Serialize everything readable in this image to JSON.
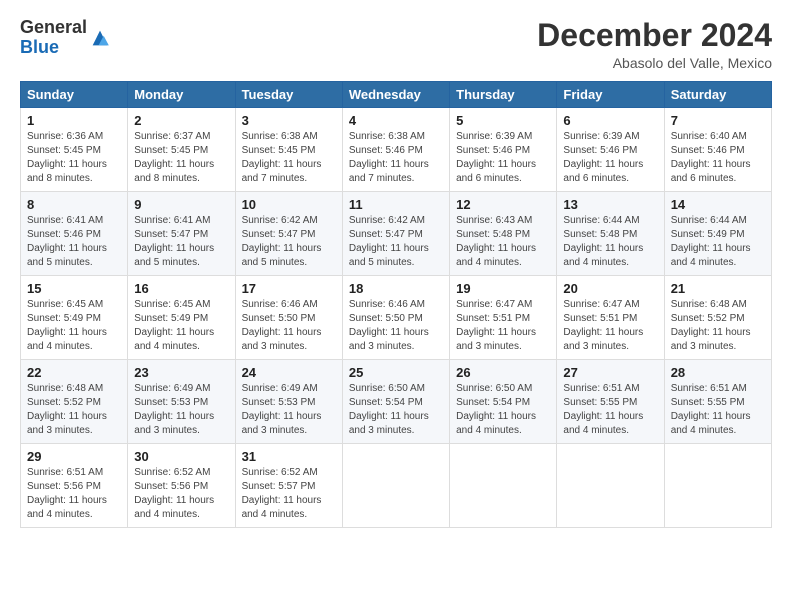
{
  "logo": {
    "general": "General",
    "blue": "Blue"
  },
  "title": "December 2024",
  "location": "Abasolo del Valle, Mexico",
  "weekdays": [
    "Sunday",
    "Monday",
    "Tuesday",
    "Wednesday",
    "Thursday",
    "Friday",
    "Saturday"
  ],
  "weeks": [
    [
      {
        "day": "1",
        "sunrise": "6:36 AM",
        "sunset": "5:45 PM",
        "daylight": "11 hours and 8 minutes."
      },
      {
        "day": "2",
        "sunrise": "6:37 AM",
        "sunset": "5:45 PM",
        "daylight": "11 hours and 8 minutes."
      },
      {
        "day": "3",
        "sunrise": "6:38 AM",
        "sunset": "5:45 PM",
        "daylight": "11 hours and 7 minutes."
      },
      {
        "day": "4",
        "sunrise": "6:38 AM",
        "sunset": "5:46 PM",
        "daylight": "11 hours and 7 minutes."
      },
      {
        "day": "5",
        "sunrise": "6:39 AM",
        "sunset": "5:46 PM",
        "daylight": "11 hours and 6 minutes."
      },
      {
        "day": "6",
        "sunrise": "6:39 AM",
        "sunset": "5:46 PM",
        "daylight": "11 hours and 6 minutes."
      },
      {
        "day": "7",
        "sunrise": "6:40 AM",
        "sunset": "5:46 PM",
        "daylight": "11 hours and 6 minutes."
      }
    ],
    [
      {
        "day": "8",
        "sunrise": "6:41 AM",
        "sunset": "5:46 PM",
        "daylight": "11 hours and 5 minutes."
      },
      {
        "day": "9",
        "sunrise": "6:41 AM",
        "sunset": "5:47 PM",
        "daylight": "11 hours and 5 minutes."
      },
      {
        "day": "10",
        "sunrise": "6:42 AM",
        "sunset": "5:47 PM",
        "daylight": "11 hours and 5 minutes."
      },
      {
        "day": "11",
        "sunrise": "6:42 AM",
        "sunset": "5:47 PM",
        "daylight": "11 hours and 5 minutes."
      },
      {
        "day": "12",
        "sunrise": "6:43 AM",
        "sunset": "5:48 PM",
        "daylight": "11 hours and 4 minutes."
      },
      {
        "day": "13",
        "sunrise": "6:44 AM",
        "sunset": "5:48 PM",
        "daylight": "11 hours and 4 minutes."
      },
      {
        "day": "14",
        "sunrise": "6:44 AM",
        "sunset": "5:49 PM",
        "daylight": "11 hours and 4 minutes."
      }
    ],
    [
      {
        "day": "15",
        "sunrise": "6:45 AM",
        "sunset": "5:49 PM",
        "daylight": "11 hours and 4 minutes."
      },
      {
        "day": "16",
        "sunrise": "6:45 AM",
        "sunset": "5:49 PM",
        "daylight": "11 hours and 4 minutes."
      },
      {
        "day": "17",
        "sunrise": "6:46 AM",
        "sunset": "5:50 PM",
        "daylight": "11 hours and 3 minutes."
      },
      {
        "day": "18",
        "sunrise": "6:46 AM",
        "sunset": "5:50 PM",
        "daylight": "11 hours and 3 minutes."
      },
      {
        "day": "19",
        "sunrise": "6:47 AM",
        "sunset": "5:51 PM",
        "daylight": "11 hours and 3 minutes."
      },
      {
        "day": "20",
        "sunrise": "6:47 AM",
        "sunset": "5:51 PM",
        "daylight": "11 hours and 3 minutes."
      },
      {
        "day": "21",
        "sunrise": "6:48 AM",
        "sunset": "5:52 PM",
        "daylight": "11 hours and 3 minutes."
      }
    ],
    [
      {
        "day": "22",
        "sunrise": "6:48 AM",
        "sunset": "5:52 PM",
        "daylight": "11 hours and 3 minutes."
      },
      {
        "day": "23",
        "sunrise": "6:49 AM",
        "sunset": "5:53 PM",
        "daylight": "11 hours and 3 minutes."
      },
      {
        "day": "24",
        "sunrise": "6:49 AM",
        "sunset": "5:53 PM",
        "daylight": "11 hours and 3 minutes."
      },
      {
        "day": "25",
        "sunrise": "6:50 AM",
        "sunset": "5:54 PM",
        "daylight": "11 hours and 3 minutes."
      },
      {
        "day": "26",
        "sunrise": "6:50 AM",
        "sunset": "5:54 PM",
        "daylight": "11 hours and 4 minutes."
      },
      {
        "day": "27",
        "sunrise": "6:51 AM",
        "sunset": "5:55 PM",
        "daylight": "11 hours and 4 minutes."
      },
      {
        "day": "28",
        "sunrise": "6:51 AM",
        "sunset": "5:55 PM",
        "daylight": "11 hours and 4 minutes."
      }
    ],
    [
      {
        "day": "29",
        "sunrise": "6:51 AM",
        "sunset": "5:56 PM",
        "daylight": "11 hours and 4 minutes."
      },
      {
        "day": "30",
        "sunrise": "6:52 AM",
        "sunset": "5:56 PM",
        "daylight": "11 hours and 4 minutes."
      },
      {
        "day": "31",
        "sunrise": "6:52 AM",
        "sunset": "5:57 PM",
        "daylight": "11 hours and 4 minutes."
      },
      null,
      null,
      null,
      null
    ]
  ],
  "labels": {
    "sunrise": "Sunrise:",
    "sunset": "Sunset:",
    "daylight": "Daylight hours"
  }
}
